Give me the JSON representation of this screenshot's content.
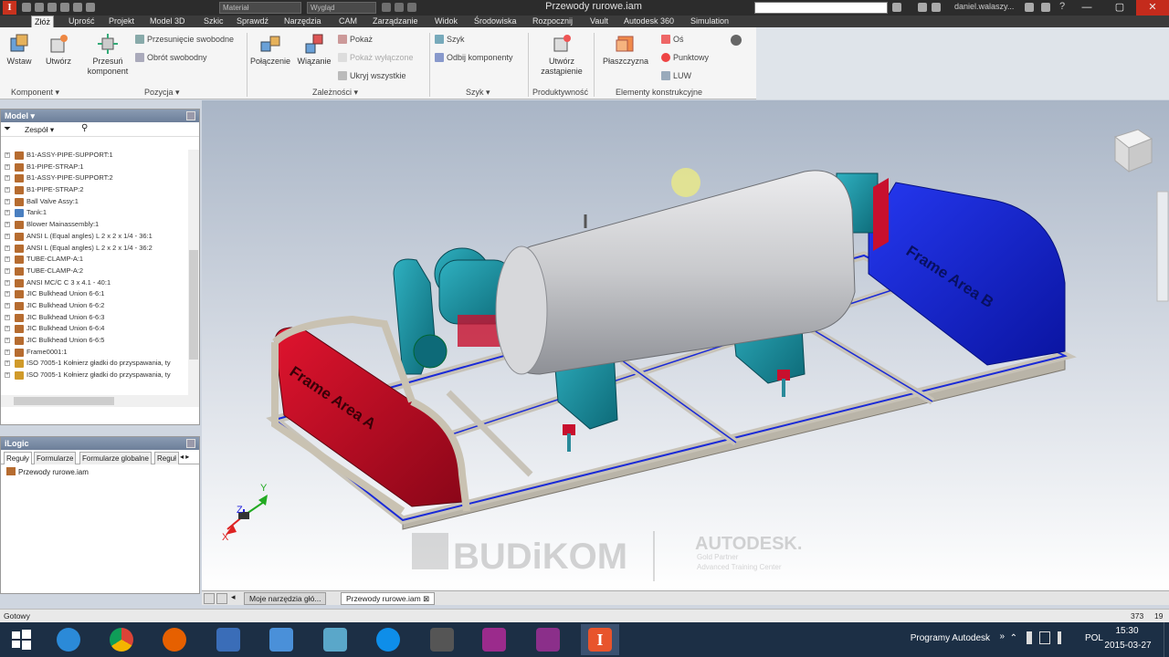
{
  "app": {
    "document_title": "Przewody rurowe.iam",
    "material_combo": "Materiał",
    "appearance_combo": "Wygląd",
    "user": "daniel.walaszy...",
    "help_glyph": "?",
    "window_controls": [
      "—",
      "▢",
      "✕"
    ]
  },
  "ribbon": {
    "tabs": [
      "Złóż",
      "Uprość",
      "Projekt",
      "Model 3D",
      "Szkic",
      "Sprawdź",
      "Narzędzia",
      "CAM",
      "Zarządzanie",
      "Widok",
      "Środowiska",
      "Rozpocznij",
      "Vault",
      "Autodesk 360",
      "Simulation"
    ],
    "active_tab": "Złóż",
    "buttons": {
      "wstaw": "Wstaw",
      "utworz": "Utwórz",
      "przesun": "Przesuń komponent",
      "przesuniecie": "Przesunięcie swobodne",
      "obrot": "Obrót swobodny",
      "polaczenie": "Połączenie",
      "wiazanie": "Wiązanie",
      "pokaz": "Pokaż",
      "pokaz_wylaczone": "Pokaż wyłączone",
      "ukryj": "Ukryj wszystkie",
      "szyk": "Szyk",
      "odbij": "Odbij komponenty",
      "zastapienie": "Utwórz zastąpienie",
      "plaszczyzna": "Płaszczyzna",
      "os": "Oś",
      "punktowy": "Punktowy",
      "luw": "LUW"
    },
    "groups": {
      "komponent": "Komponent ▾",
      "pozycja": "Pozycja ▾",
      "zaleznosci": "Zależności ▾",
      "szyk": "Szyk ▾",
      "produktywnosc": "Produktywność",
      "elementy": "Elementy konstrukcyjne"
    }
  },
  "browser": {
    "title": "Model ▾",
    "dropdown": "Zespół",
    "items": [
      "B1-ASSY-PIPE-SUPPORT:1",
      "B1-PIPE-STRAP:1",
      "B1-ASSY-PIPE-SUPPORT:2",
      "B1-PIPE-STRAP:2",
      "Ball Valve Assy:1",
      "Tank:1",
      "Blower Mainassembly:1",
      "ANSI L (Equal angles) L 2 x 2 x 1/4 - 36:1",
      "ANSI L (Equal angles) L 2 x 2 x 1/4 - 36:2",
      "TUBE-CLAMP-A:1",
      "TUBE-CLAMP-A:2",
      "ANSI MC/C C 3 x 4.1 - 40:1",
      "JIC Bulkhead Union 6-6:1",
      "JIC Bulkhead Union 6-6:2",
      "JIC Bulkhead Union 6-6:3",
      "JIC Bulkhead Union 6-6:4",
      "JIC Bulkhead Union 6-6:5",
      "Frame0001:1",
      "ISO 7005-1 Kołnierz gładki do przyspawania, ty",
      "ISO 7005-1 Kołnierz gładki do przyspawania, ty"
    ]
  },
  "ilogic": {
    "title": "iLogic",
    "tabs": [
      "Reguły",
      "Formularze",
      "Formularze globalne",
      "Reguł"
    ],
    "items": [
      "Przewody rurowe.iam"
    ]
  },
  "viewport": {
    "frame_label_a": "Frame Area A",
    "frame_label_b": "Frame Area B",
    "watermark_left": "BUDiKOM",
    "watermark_right": "AUTODESK.",
    "watermark_small1": "Gold Partner",
    "watermark_small2": "Advanced Training Center",
    "axis_x": "X",
    "axis_y": "Y",
    "axis_z": "Z"
  },
  "doc_tabs": [
    "Moje narzędzia głó...",
    "Przewody rurowe.iam"
  ],
  "status": {
    "left": "Gotowy",
    "right1": "373",
    "right2": "19"
  },
  "taskbar": {
    "apps": [
      "start",
      "ie",
      "chrome",
      "firefox",
      "outlook",
      "browser2",
      "app",
      "teamviewer",
      "explorer",
      "app2",
      "app3",
      "inventor"
    ],
    "tray_label": "Programy Autodesk",
    "lang": "POL",
    "time": "15:30",
    "date": "2015-03-27"
  },
  "colors": {
    "frame_red": "#c8102e",
    "frame_blue": "#1020c8",
    "tank_grey": "#c8c9cc",
    "pump_teal": "#1a8a9a"
  }
}
